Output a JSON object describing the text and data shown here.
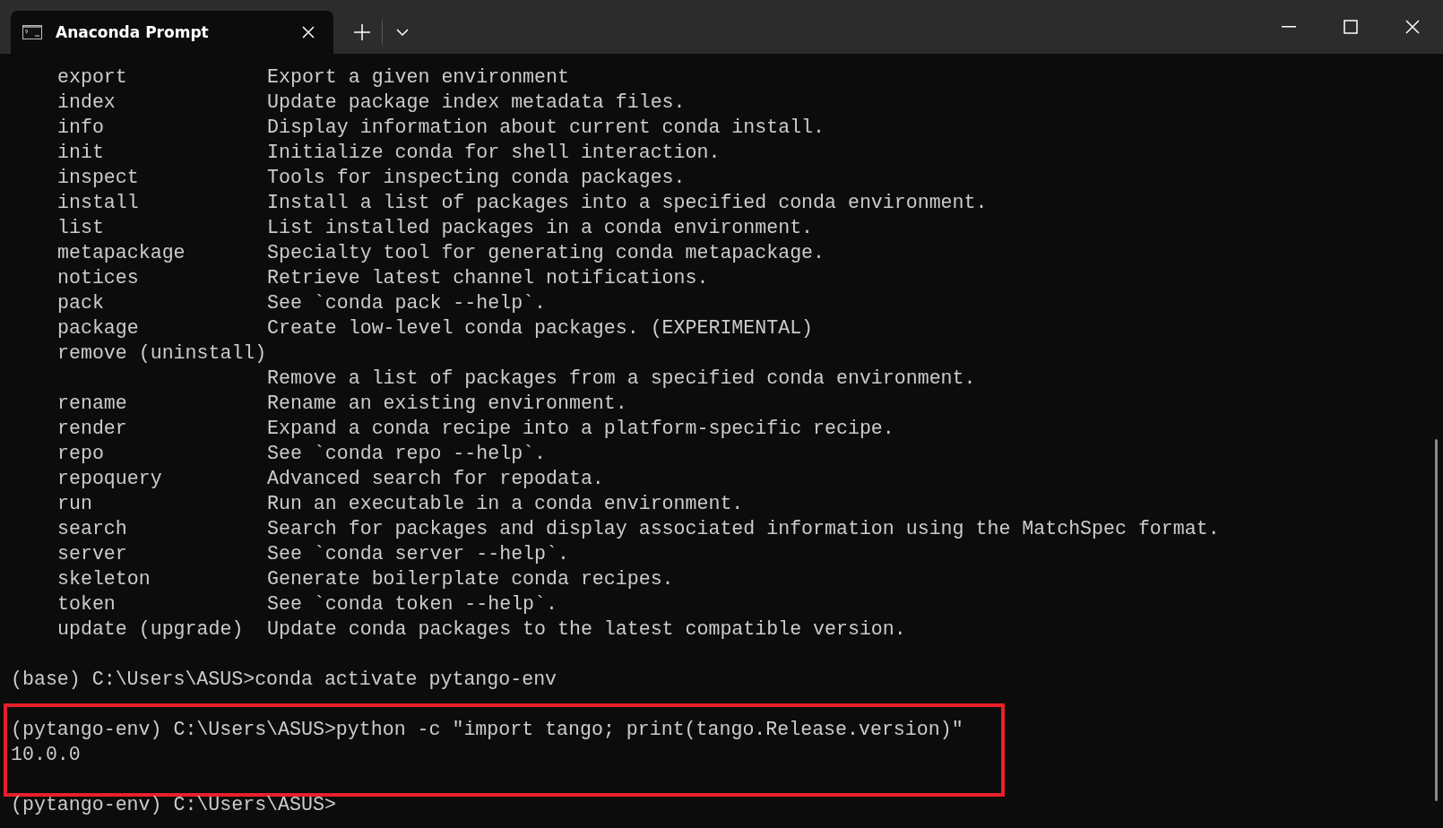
{
  "window": {
    "tab": {
      "title": "Anaconda Prompt",
      "selected": true
    }
  },
  "terminal": {
    "commands": [
      {
        "name": "export",
        "description": "Export a given environment"
      },
      {
        "name": "index",
        "description": "Update package index metadata files."
      },
      {
        "name": "info",
        "description": "Display information about current conda install."
      },
      {
        "name": "init",
        "description": "Initialize conda for shell interaction."
      },
      {
        "name": "inspect",
        "description": "Tools for inspecting conda packages."
      },
      {
        "name": "install",
        "description": "Install a list of packages into a specified conda environment."
      },
      {
        "name": "list",
        "description": "List installed packages in a conda environment."
      },
      {
        "name": "metapackage",
        "description": "Specialty tool for generating conda metapackage."
      },
      {
        "name": "notices",
        "description": "Retrieve latest channel notifications."
      },
      {
        "name": "pack",
        "description": "See `conda pack --help`."
      },
      {
        "name": "package",
        "description": "Create low-level conda packages. (EXPERIMENTAL)"
      },
      {
        "name": "remove (uninstall)"
      },
      {
        "description": "Remove a list of packages from a specified conda environment."
      },
      {
        "name": "rename",
        "description": "Rename an existing environment."
      },
      {
        "name": "render",
        "description": "Expand a conda recipe into a platform-specific recipe."
      },
      {
        "name": "repo",
        "description": "See `conda repo --help`."
      },
      {
        "name": "repoquery",
        "description": "Advanced search for repodata."
      },
      {
        "name": "run",
        "description": "Run an executable in a conda environment."
      },
      {
        "name": "search",
        "description": "Search for packages and display associated information using the MatchSpec format."
      },
      {
        "name": "server",
        "description": "See `conda server --help`."
      },
      {
        "name": "skeleton",
        "description": "Generate boilerplate conda recipes."
      },
      {
        "name": "token",
        "description": "See `conda token --help`."
      },
      {
        "name": "update (upgrade)",
        "description": "Update conda packages to the latest compatible version."
      }
    ],
    "session": [
      {
        "text": "(base) C:\\Users\\ASUS>conda activate pytango-env",
        "highlighted": false
      },
      {
        "text": "(pytango-env) C:\\Users\\ASUS>python -c \"import tango; print(tango.Release.version)\"",
        "highlighted": true
      },
      {
        "text": "10.0.0",
        "highlighted": true
      },
      {
        "text": "(pytango-env) C:\\Users\\ASUS>",
        "highlighted": false
      }
    ]
  }
}
